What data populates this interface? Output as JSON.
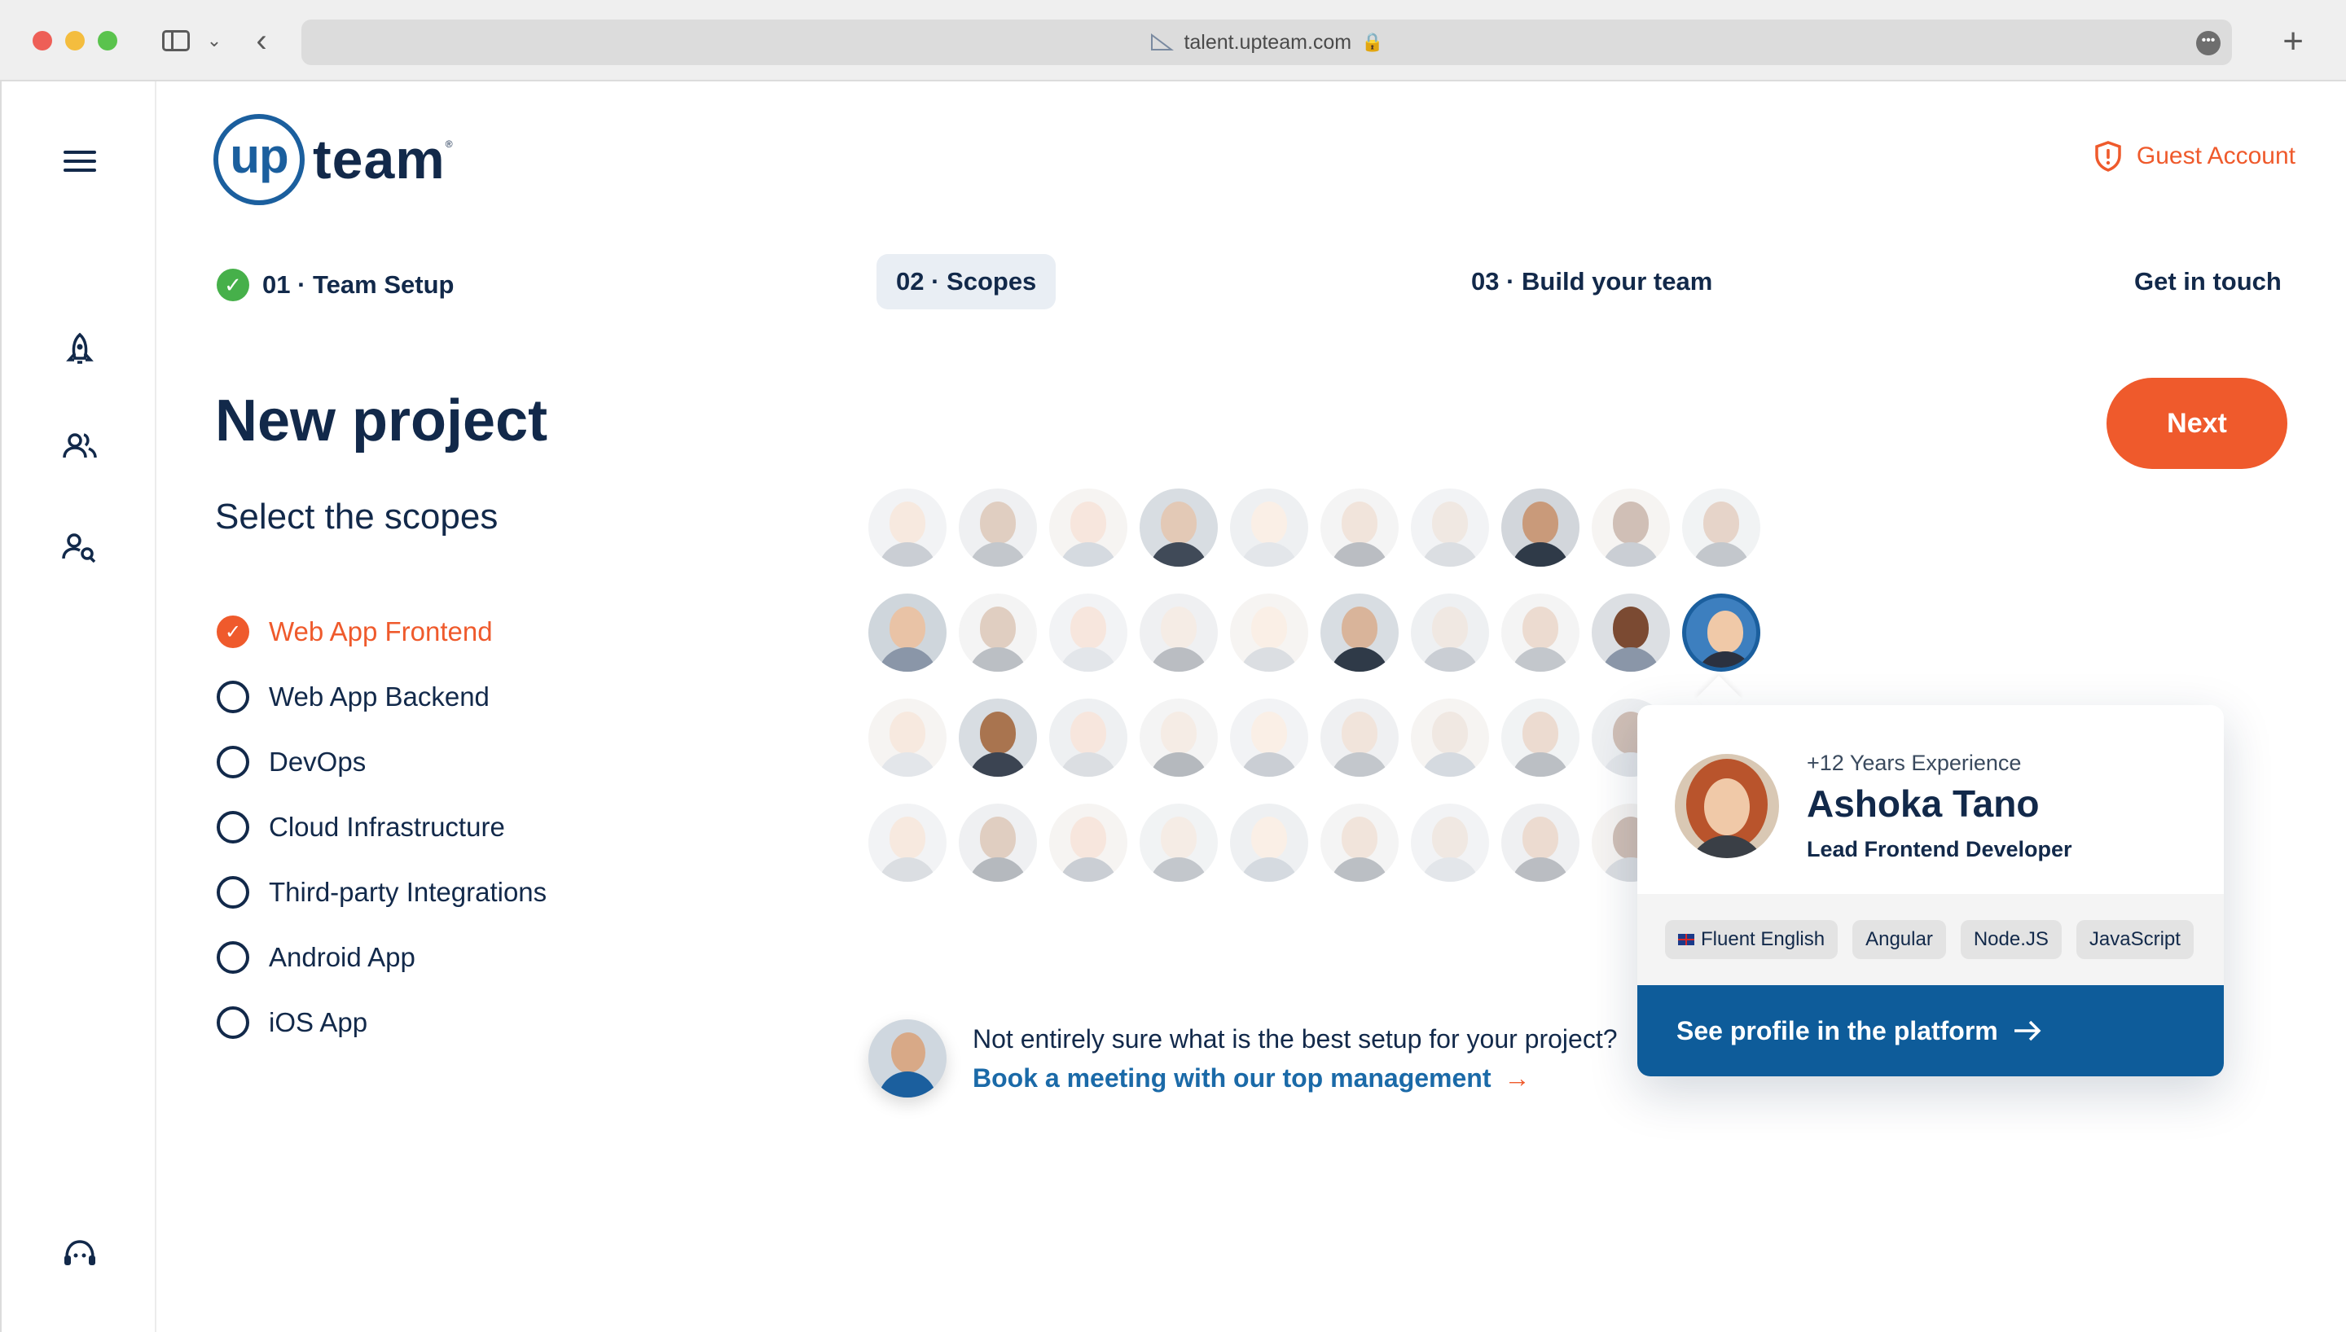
{
  "browser": {
    "url": "talent.upteam.com"
  },
  "logo": {
    "up": "up",
    "team": "team",
    "reg": "®"
  },
  "header": {
    "guest_account": "Guest Account"
  },
  "steps": {
    "step1": "01 · Team Setup",
    "step2": "02 · Scopes",
    "step3": "03 · Build your team",
    "step4": "Get in touch"
  },
  "main": {
    "title": "New project",
    "subtitle": "Select the scopes",
    "next_label": "Next"
  },
  "scopes": [
    {
      "label": "Web App Frontend",
      "checked": true
    },
    {
      "label": "Web App Backend",
      "checked": false
    },
    {
      "label": "DevOps",
      "checked": false
    },
    {
      "label": "Cloud Infrastructure",
      "checked": false
    },
    {
      "label": "Third-party Integrations",
      "checked": false
    },
    {
      "label": "Android App",
      "checked": false
    },
    {
      "label": "iOS App",
      "checked": false
    }
  ],
  "profile": {
    "experience": "+12 Years Experience",
    "name": "Ashoka Tano",
    "role": "Lead Frontend Developer",
    "tags": [
      "Fluent English",
      "Angular",
      "Node.JS",
      "JavaScript"
    ],
    "cta": "See profile in the platform"
  },
  "meeting": {
    "question": "Not entirely sure what is the best setup for your project?",
    "link": "Book a meeting with our top management"
  },
  "colors": {
    "brand_orange": "#ef5a2c",
    "brand_blue": "#1b5f9e",
    "navy": "#12294a",
    "success": "#46b04a"
  }
}
